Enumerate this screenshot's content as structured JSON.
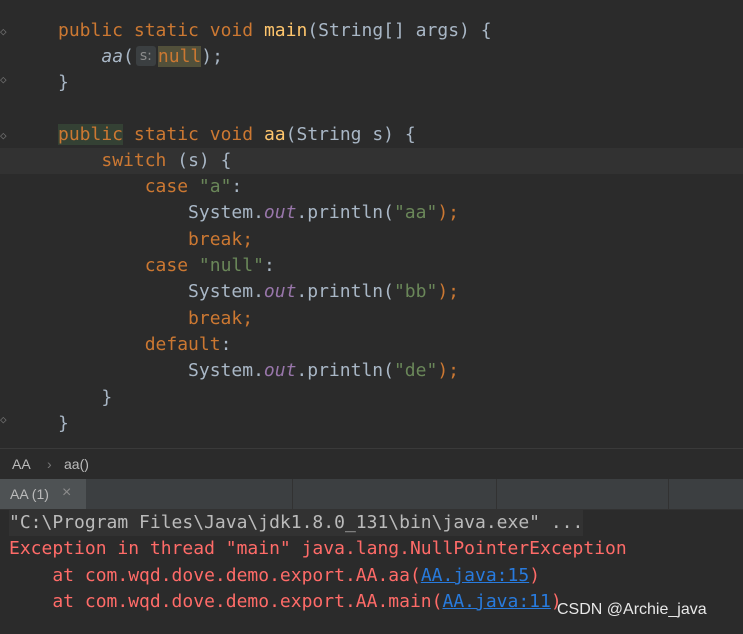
{
  "editor": {
    "line1": {
      "kw1": "public",
      "kw2": "static",
      "kw3": "void",
      "fn": "main",
      "rest": "(String[] args) {"
    },
    "line2": {
      "call": "aa",
      "open": "(",
      "hint": "s:",
      "arg": "null",
      "close": ");"
    },
    "line3": "}",
    "line5": {
      "kw1": "public",
      "kw2": "static",
      "kw3": "void",
      "fn": "aa",
      "rest": "(String s) {"
    },
    "line6": {
      "kw": "switch",
      "rest": " (s) {"
    },
    "line7": {
      "kw": "case",
      "str": "\"a\"",
      "rest": ":"
    },
    "line8": {
      "cls": "System.",
      "fld": "out",
      "method": ".println(",
      "str": "\"aa\"",
      "end": ");"
    },
    "line9": {
      "kw": "break",
      "end": ";"
    },
    "line10": {
      "kw": "case",
      "str": "\"null\"",
      "rest": ":"
    },
    "line11": {
      "cls": "System.",
      "fld": "out",
      "method": ".println(",
      "str": "\"bb\"",
      "end": ");"
    },
    "line12": {
      "kw": "break",
      "end": ";"
    },
    "line13": {
      "kw": "default",
      "rest": ":"
    },
    "line14": {
      "cls": "System.",
      "fld": "out",
      "method": ".println(",
      "str": "\"de\"",
      "end": ");"
    },
    "line15": "}",
    "line16": "}"
  },
  "breadcrumb": {
    "class": "AA",
    "sep": "›",
    "method": "aa()"
  },
  "run_tab": {
    "label": "AA (1)",
    "close": "×"
  },
  "console": {
    "cmd": "\"C:\\Program Files\\Java\\jdk1.8.0_131\\bin\\java.exe\" ...",
    "exception": "Exception in thread \"main\" java.lang.NullPointerException",
    "trace1": {
      "prefix": "    at com.wqd.dove.demo.export.AA.aa(",
      "link": "AA.java:15",
      "suffix": ")"
    },
    "trace2": {
      "prefix": "    at com.wqd.dove.demo.export.AA.main(",
      "link": "AA.java:11",
      "suffix": ")"
    }
  },
  "watermark": "CSDN @Archie_java",
  "colors": {
    "keyword": "#cc7832",
    "string": "#6a8759",
    "error": "#ff6b68",
    "link": "#287bde"
  }
}
